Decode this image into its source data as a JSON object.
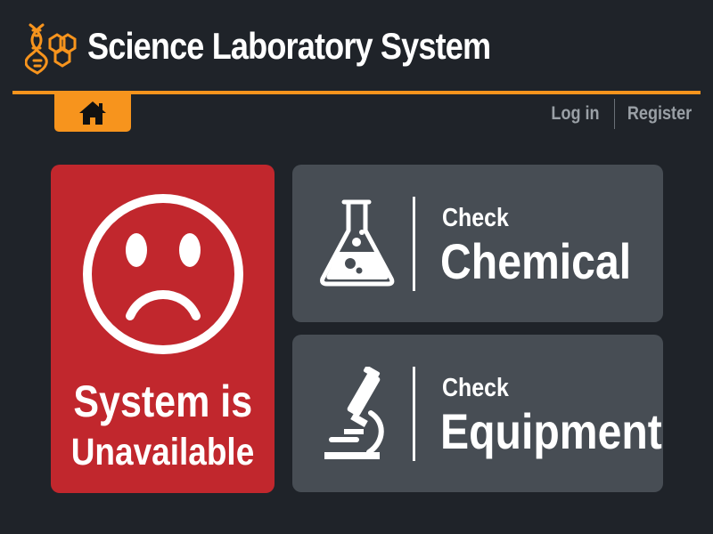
{
  "header": {
    "title": "Science Laboratory System",
    "logo_icon": "dna-hexagon-icon"
  },
  "nav": {
    "home_icon": "home-icon",
    "login_label": "Log in",
    "register_label": "Register"
  },
  "status": {
    "line1": "System is",
    "line2": "Unavailable",
    "icon": "sad-face-icon"
  },
  "cards": [
    {
      "kicker": "Check",
      "title": "Chemical",
      "icon": "flask-icon"
    },
    {
      "kicker": "Check",
      "title": "Equipment",
      "icon": "microscope-icon"
    }
  ],
  "colors": {
    "background": "#1f2329",
    "accent": "#f7941d",
    "error": "#c1272d",
    "card": "#474d54",
    "muted_text": "#9aa0a6"
  }
}
